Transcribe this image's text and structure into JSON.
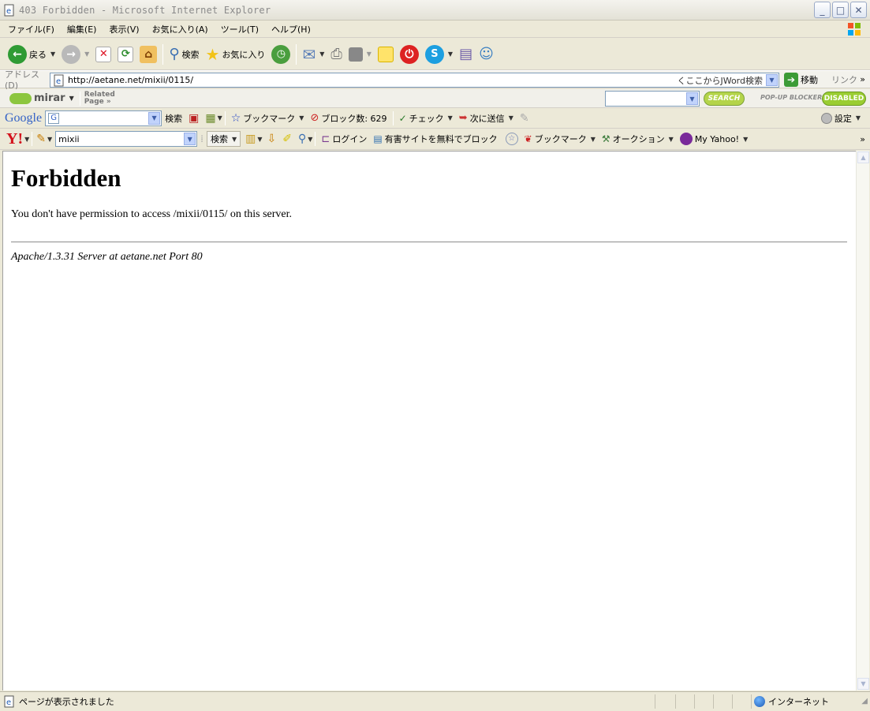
{
  "window": {
    "title": "403 Forbidden - Microsoft Internet Explorer",
    "minimize": "_",
    "maximize": "□",
    "close": "✕"
  },
  "menu": [
    "ファイル(F)",
    "編集(E)",
    "表示(V)",
    "お気に入り(A)",
    "ツール(T)",
    "ヘルプ(H)"
  ],
  "toolbar": {
    "back": "戻る",
    "search": "検索",
    "favorites": "お気に入り"
  },
  "address": {
    "label": "アドレス(D)",
    "url": "http://aetane.net/mixii/0115/",
    "jword": "くここからJWord検索",
    "go": "移動",
    "links": "リンク"
  },
  "mirar": {
    "logo": "mirar",
    "related": "Related",
    "page": "Page »",
    "search": "SEARCH",
    "popup": "POP-UP BLOCKER",
    "disabled": "DISABLED"
  },
  "google": {
    "logo": "Google",
    "search": "検索",
    "bookmarks": "ブックマーク",
    "blocked": "ブロック数: 629",
    "check": "チェック",
    "send": "次に送信",
    "settings": "設定"
  },
  "yahoo": {
    "logo": "Y!",
    "query": "mixii",
    "search": "検索",
    "login": "ログイン",
    "block": "有害サイトを無料でブロック",
    "bookmarks": "ブックマーク",
    "auction": "オークション",
    "myyahoo": "My Yahoo!"
  },
  "page": {
    "heading": "Forbidden",
    "message": "You don't have permission to access /mixii/0115/ on this server.",
    "address": "Apache/1.3.31 Server at aetane.net Port 80"
  },
  "status": {
    "text": "ページが表示されました",
    "zone": "インターネット"
  }
}
